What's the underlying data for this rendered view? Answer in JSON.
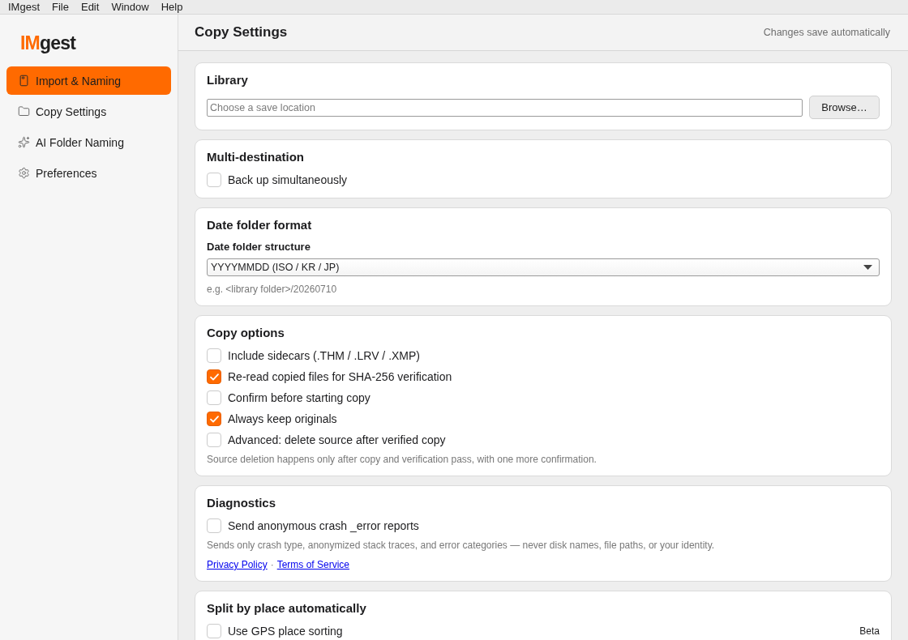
{
  "menu_bar": [
    "IMgest",
    "File",
    "Edit",
    "Window",
    "Help"
  ],
  "sidebar": {
    "logo": {
      "accent": "IM",
      "rest": "gest"
    },
    "items": [
      {
        "label": "Import & Naming",
        "selected": true
      },
      {
        "label": "Copy Settings",
        "selected": false
      },
      {
        "label": "AI Folder Naming",
        "selected": false
      },
      {
        "label": "Preferences",
        "selected": false
      }
    ]
  },
  "header": {
    "title": "Copy Settings",
    "status": "Changes save automatically"
  },
  "sections": [
    {
      "title": "Library",
      "items": [
        {
          "kind": "path",
          "placeholder": "Choose a save location",
          "button": "Browse…"
        }
      ]
    },
    {
      "title": "Multi-destination",
      "items": [
        {
          "kind": "checkbox",
          "label": "Back up simultaneously",
          "checked": false
        }
      ]
    },
    {
      "title": "Date folder format",
      "items": [
        {
          "kind": "label",
          "text": "Date folder structure"
        },
        {
          "kind": "select",
          "value": "YYYYMMDD (ISO / KR / JP)"
        },
        {
          "kind": "hint",
          "text": "e.g. <library folder>/20260710"
        }
      ]
    },
    {
      "title": "Copy options",
      "items": [
        {
          "kind": "checkbox",
          "label": "Include sidecars (.THM / .LRV / .XMP)",
          "checked": false
        },
        {
          "kind": "checkbox",
          "label": "Re-read copied files for SHA-256 verification",
          "checked": true
        },
        {
          "kind": "checkbox",
          "label": "Confirm before starting copy",
          "checked": false
        },
        {
          "kind": "checkbox",
          "label": "Always keep originals",
          "checked": true
        },
        {
          "kind": "checkbox",
          "label": "Advanced: delete source after verified copy",
          "checked": false
        },
        {
          "kind": "hint",
          "text": "Source deletion happens only after copy and verification pass, with one more confirmation."
        }
      ]
    },
    {
      "title": "Diagnostics",
      "items": [
        {
          "kind": "checkbox",
          "label": "Send anonymous crash _error reports",
          "checked": false
        },
        {
          "kind": "hint",
          "text": "Sends only crash type, anonymized stack traces, and error categories — never disk names, file paths, or your identity."
        },
        {
          "kind": "links",
          "links": [
            "Privacy Policy",
            "Terms of Service"
          ],
          "separator": "·"
        }
      ]
    },
    {
      "title": "Split by place automatically",
      "items": [
        {
          "kind": "checkbox",
          "label": "Use GPS place sorting",
          "checked": false,
          "badge": "Beta"
        }
      ]
    }
  ]
}
